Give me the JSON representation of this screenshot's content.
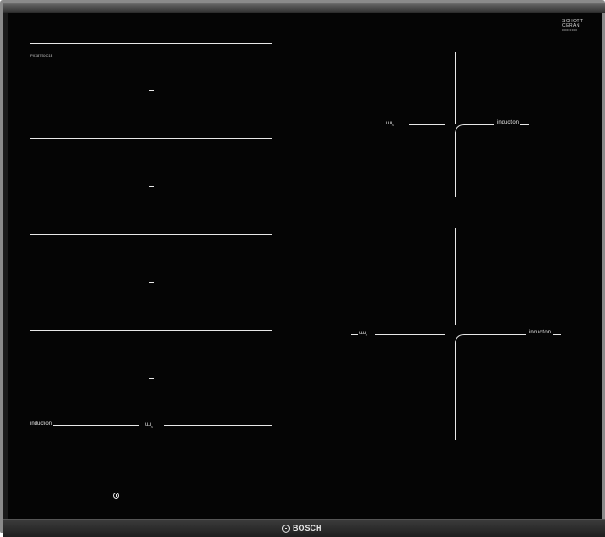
{
  "model_code": "PXX875DC1E",
  "glass_brand": {
    "line1": "SCHOTT",
    "line2": "CERAN",
    "code": "00000000"
  },
  "left_zones": {
    "induction_label": "induction",
    "wave_symbol": "ɯɹ˷",
    "zone_markers": [
      "—",
      "—",
      "—",
      "—"
    ]
  },
  "right_zones": [
    {
      "induction_label": "induction",
      "wave_symbol": "ɯɹ˷"
    },
    {
      "induction_label": "induction",
      "wave_symbol": "ɯɹ˷"
    }
  ],
  "power_icon": "power-icon",
  "brand": "BOSCH"
}
